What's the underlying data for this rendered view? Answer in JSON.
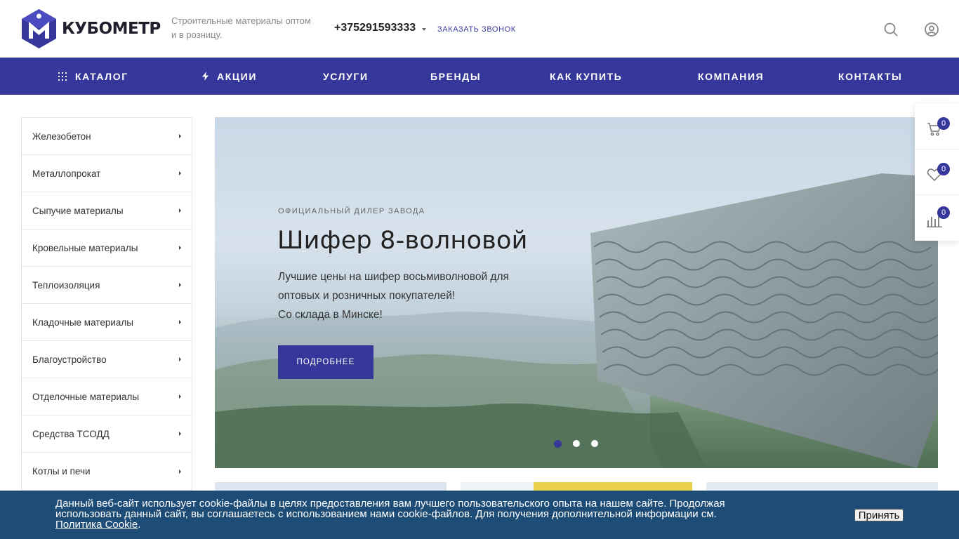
{
  "header": {
    "logo_text": "КУБОМЕТР",
    "slogan": "Строительные материалы оптом и в розницу.",
    "phone": "+375291593333",
    "callback_label": "ЗАКАЗАТЬ ЗВОНОК",
    "search_icon": "search-icon",
    "user_icon": "user-icon"
  },
  "nav": {
    "items": [
      {
        "label": "КАТАЛОГ",
        "icon": "grid-icon"
      },
      {
        "label": "АКЦИИ",
        "icon": "lightning-icon"
      },
      {
        "label": "УСЛУГИ"
      },
      {
        "label": "БРЕНДЫ"
      },
      {
        "label": "КАК КУПИТЬ"
      },
      {
        "label": "КОМПАНИЯ"
      },
      {
        "label": "КОНТАКТЫ"
      }
    ]
  },
  "sidebar": {
    "items": [
      {
        "label": "Железобетон"
      },
      {
        "label": "Металлопрокат"
      },
      {
        "label": "Сыпучие материалы"
      },
      {
        "label": "Кровельные материалы"
      },
      {
        "label": "Теплоизоляция"
      },
      {
        "label": "Кладочные материалы"
      },
      {
        "label": "Благоустройство"
      },
      {
        "label": "Отделочные материалы"
      },
      {
        "label": "Средства ТСОДД"
      },
      {
        "label": "Котлы и печи"
      }
    ]
  },
  "banner": {
    "kicker": "ОФИЦИАЛЬНЫЙ ДИЛЕР ЗАВОДА",
    "title": "Шифер 8-волновой",
    "text_line1": "Лучшие цены на шифер восьмиволновой для",
    "text_line2": "оптовых и розничных покупателей!",
    "text_line3": "Со склада в Минске!",
    "button_label": "ПОДРОБНЕЕ",
    "slides_total": 3,
    "active_slide": 1
  },
  "floating": {
    "cart_count": "0",
    "favorites_count": "0",
    "compare_count": "0"
  },
  "cookie": {
    "text": "Данный веб-сайт использует cookie-файлы в целях предоставления вам лучшего пользовательского опыта на нашем сайте. Продолжая использовать данный сайт, вы соглашаетесь с использованием нами cookie-файлов. Для получения дополнительной информации см.",
    "link_label": "Политика Cookie",
    "accept_label": "Принять"
  },
  "colors": {
    "brand": "#36379a",
    "cookie_bg": "#1d4c76"
  }
}
